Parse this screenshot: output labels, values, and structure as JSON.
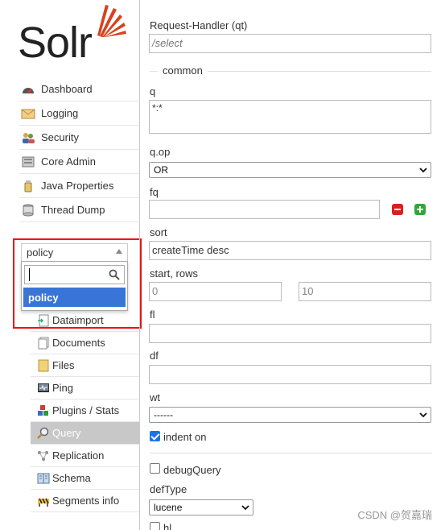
{
  "logo": {
    "text": "Solr",
    "accent_color": "#d9411e"
  },
  "sidebar": {
    "items": [
      {
        "label": "Dashboard",
        "icon": "dashboard-gauge-icon"
      },
      {
        "label": "Logging",
        "icon": "logging-envelope-icon"
      },
      {
        "label": "Security",
        "icon": "security-users-icon"
      },
      {
        "label": "Core Admin",
        "icon": "core-admin-icon"
      },
      {
        "label": "Java Properties",
        "icon": "java-properties-icon"
      },
      {
        "label": "Thread Dump",
        "icon": "thread-dump-icon"
      }
    ]
  },
  "core_selector": {
    "selected": "policy",
    "search_value": "",
    "options": [
      "policy"
    ],
    "highlight_color": "#e11111"
  },
  "core_menu": {
    "items": [
      {
        "label": "Dataimport",
        "icon": "dataimport-icon",
        "active": false
      },
      {
        "label": "Documents",
        "icon": "documents-icon",
        "active": false
      },
      {
        "label": "Files",
        "icon": "files-icon",
        "active": false
      },
      {
        "label": "Ping",
        "icon": "ping-icon",
        "active": false
      },
      {
        "label": "Plugins / Stats",
        "icon": "plugins-icon",
        "active": false
      },
      {
        "label": "Query",
        "icon": "query-magnifier-icon",
        "active": true
      },
      {
        "label": "Replication",
        "icon": "replication-icon",
        "active": false
      },
      {
        "label": "Schema",
        "icon": "schema-icon",
        "active": false
      },
      {
        "label": "Segments info",
        "icon": "segments-icon",
        "active": false
      }
    ]
  },
  "query": {
    "qt_label": "Request-Handler (qt)",
    "qt_value": "/select",
    "common_legend": "common",
    "q_label": "q",
    "q_value": "*:*",
    "qop_label": "q.op",
    "qop_value": "OR",
    "fq_label": "fq",
    "fq_value": "",
    "sort_label": "sort",
    "sort_value": "createTime desc",
    "start_rows_label": "start, rows",
    "start_value": "0",
    "rows_value": "10",
    "fl_label": "fl",
    "fl_value": "",
    "df_label": "df",
    "df_value": "",
    "wt_label": "wt",
    "wt_value": "------",
    "indent_label": "indent on",
    "indent_checked": true,
    "debug_label": "debugQuery",
    "debug_checked": false,
    "deftype_label": "defType",
    "deftype_value": "lucene",
    "hl_label": "hl"
  },
  "watermark": "CSDN @贺嘉瑞"
}
